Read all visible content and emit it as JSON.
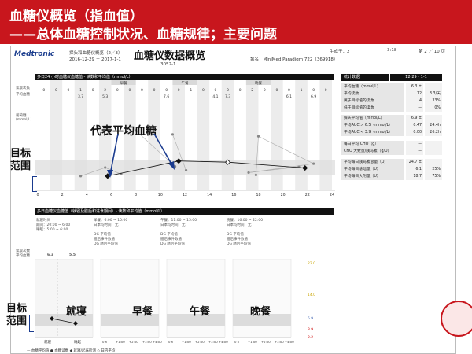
{
  "slide": {
    "title_line1": "血糖仪概览（指血值）",
    "title_line2": "——总体血糖控制状况、血糖规律；主要问题",
    "callout_title": "血糖仪数据概览",
    "annotation_average": "代表平均血糖",
    "annotation_target_top": "目标\n范围",
    "annotation_target_bottom": "目标\n范围",
    "meal_labels": [
      "就寝",
      "早餐",
      "午餐",
      "晚餐"
    ],
    "colors": {
      "brand_red": "#c8161d",
      "annotation_blue": "#1a3b8f",
      "chart_black": "#111111",
      "shade_gray": "#e8e8e8"
    }
  },
  "report": {
    "logo_text": "Medtronic",
    "report_name": "探头和血糖仪概览（2／3）",
    "date_range": "2016-12-29 － 2017-1-1",
    "patient_id": "3052-1",
    "pump_label": "泵名：MiniMed Paradigm 722（369918）",
    "generated_label": "生成于：2",
    "time_label": "3:18",
    "page_label": "第 2 ／ 10 页",
    "section1_title": "多日24 小时血糖仪血糖值 - 读数和平均值（mmol/L）",
    "section2_title": "多日血糖仪血糖值（就寝及膳后和进食期间）- 读数和平均值（mmol/L）",
    "row_label_readings": "读取次数",
    "row_label_average": "平均血糖",
    "axis_label": "葡萄糖\n(mmol/L)",
    "meal_tags": [
      "早餐",
      "午餐",
      "晚餐"
    ],
    "top_counts": [
      "0",
      "0",
      "0",
      "1",
      "0",
      "2",
      "0",
      "0",
      "0",
      "0",
      "0",
      "0",
      "1",
      "0",
      "0",
      "0",
      "0",
      "2",
      "0",
      "0",
      "0",
      "1",
      "0",
      "0"
    ],
    "top_averages": [
      "3.7",
      "5.3",
      "7.6",
      "4.1",
      "7.3",
      "6.1",
      "6.9"
    ],
    "bedtime_header": "就寝时间\n期间：20:00 ~ 6:00\n睡眠：5:00 ~ 6:00",
    "breakfast_header": "早餐：6:00 ~ 10:00\n日本均时间：无",
    "lunch_header": "午餐：11:00 ~ 15:00\n日本均时间：无",
    "dinner_header": "晚餐：16:00 ~ 22:00\n日本均时间：无",
    "col_reads_label": "读数 平均值",
    "meal_subrows": [
      "DG 平均值",
      "膳后事件数值",
      "DG 膳后平均值"
    ],
    "bedtime_values": [
      "6.3",
      "5.5"
    ],
    "bottom_x_labels": [
      "就寝",
      "睡起"
    ],
    "meal_x_labels": [
      "0 h",
      "+1:00",
      "+2:00",
      "+3:00 +4:00"
    ],
    "right_axis_values": [
      "22.0",
      "14.0",
      "5.9",
      "3.9",
      "2.2",
      "0.0"
    ],
    "legend_text": "— 血糖平均值    ● 血糖读数    ◆ 就寝/起床检测    ◇ 日内平均"
  },
  "stats": {
    "header": "统计数据",
    "date_header": "12-29 - 1-1",
    "rows": [
      {
        "label": "平均血糖（mmol/L）",
        "v1": "6.3 ± 1.6",
        "v2": ""
      },
      {
        "label": "平均读数",
        "v1": "12",
        "v2": "3.3/天"
      },
      {
        "label": "属于目标值的读数",
        "v1": "4",
        "v2": "33%"
      },
      {
        "label": "低于目标值的读数",
        "v1": "—",
        "v2": "0%"
      },
      {
        "label": "探头平均值（mmol/L）",
        "v1": "6.9 ± 1.6",
        "v2": ""
      },
      {
        "label": "平均AUC > 6.5（mmol/L）",
        "v1": "0.47",
        "v2": "24.4h"
      },
      {
        "label": "平均AUC < 3.9（mmol/L）",
        "v1": "0.00",
        "v2": "26.2h"
      },
      {
        "label": "每日平均 CHO（g）",
        "v1": "—",
        "v2": ""
      },
      {
        "label": "CHO 大致量/胰岛素（g/U）",
        "v1": "—",
        "v2": ""
      },
      {
        "label": "平均每日胰岛素总量（U）",
        "v1": "24.7 ± 9.1",
        "v2": ""
      },
      {
        "label": "平均每日基础量（U）",
        "v1": "6.1",
        "v2": "25%"
      },
      {
        "label": "平均每日大剂量（U）",
        "v1": "18.7",
        "v2": "75%"
      }
    ]
  },
  "chart_data": {
    "type": "scatter",
    "title": "多日24 小时血糖仪血糖值 - 读数和平均值（mmol/L）",
    "x": "hour",
    "xlim": [
      0,
      24
    ],
    "x_ticks": [
      "0",
      "2",
      "4",
      "6",
      "8",
      "10",
      "12",
      "14",
      "16",
      "18",
      "20",
      "22",
      "24"
    ],
    "ylim": [
      0,
      22
    ],
    "target_range": [
      3.9,
      7.8
    ],
    "series": [
      {
        "name": "血糖读数",
        "points": [
          [
            3.5,
            3.7
          ],
          [
            5.5,
            5.9
          ],
          [
            6.8,
            4.2
          ],
          [
            8.0,
            15.5
          ],
          [
            11.0,
            14.5
          ],
          [
            11.2,
            6.2
          ],
          [
            12.1,
            5.2
          ],
          [
            17.8,
            4.0
          ],
          [
            18.0,
            14.0
          ],
          [
            21.3,
            6.1
          ],
          [
            22.5,
            6.9
          ],
          [
            17.2,
            4.6
          ]
        ]
      },
      {
        "name": "日内平均",
        "points": [
          [
            5.7,
            3.7
          ],
          [
            11.5,
            7.6
          ],
          [
            15.5,
            7.3
          ],
          [
            21.8,
            5.8
          ]
        ]
      }
    ]
  }
}
